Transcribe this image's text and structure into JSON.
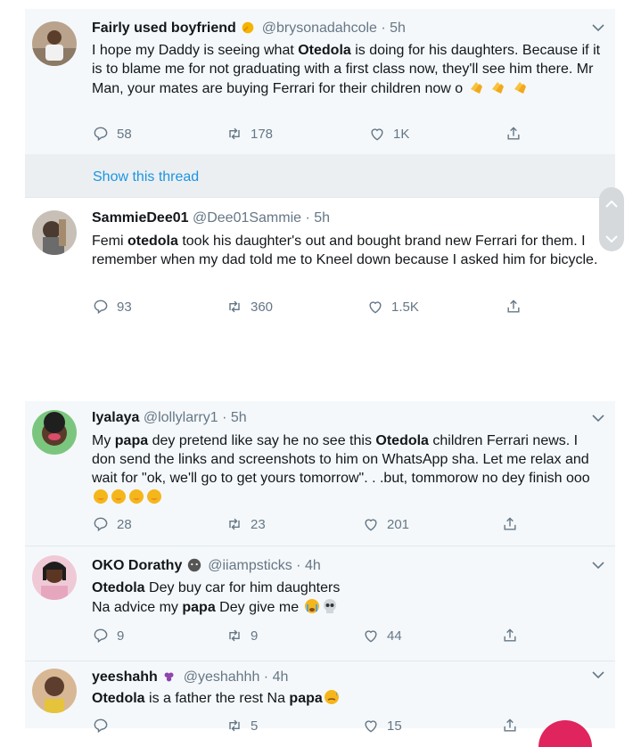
{
  "tweets": [
    {
      "name": "Fairly used boyfriend",
      "handle": "@brysonadahcole · 5h",
      "text_html": "I hope my Daddy is seeing what <b>Otedola</b> is doing for his daughters. Because if it is to blame me for not graduating with a first class now, they'll see him there. Mr Man, your mates are buying Ferrari for their children now o",
      "replies": "58",
      "retweets": "178",
      "likes": "1K"
    },
    {
      "name": "SammieDee01",
      "handle": "@Dee01Sammie · 5h",
      "text_html": "Femi <b>otedola</b> took his daughter's out and bought brand new Ferrari for them. I remember when my dad told me to Kneel down because I asked him for bicycle.",
      "replies": "93",
      "retweets": "360",
      "likes": "1.5K"
    },
    {
      "name": "Iyalaya",
      "handle": "@lollylarry1 · 5h",
      "text_html": "My <b>papa</b> dey pretend like say he no see this <b>Otedola</b> children Ferrari news. I don send the links and screenshots to him on WhatsApp sha. Let me relax and wait for \"ok, we'll go to get yours tomorrow\". . .but, tommorow no dey finish ooo",
      "replies": "28",
      "retweets": "23",
      "likes": "201"
    },
    {
      "name": "OKO Dorathy",
      "handle": "@iiampsticks · 4h",
      "text_html": "<b>Otedola</b> Dey buy car for him daughters<br>Na advice my <b>papa</b> Dey give me",
      "replies": "9",
      "retweets": "9",
      "likes": "44"
    },
    {
      "name": "yeeshahh",
      "handle": "@yeshahhh · 4h",
      "text_html": "<b>Otedola</b> is a father the rest Na <b>papa</b>",
      "replies": "",
      "retweets": "5",
      "likes": "15"
    }
  ],
  "thread_link": "Show this thread",
  "colors": {
    "accent": "#1b95e0",
    "muted": "#657786",
    "bg_alt": "#f5f8fa"
  },
  "icons": [
    "reply-icon",
    "retweet-icon",
    "like-icon",
    "share-icon",
    "chevron-down-icon",
    "clap-emoji",
    "crying-emoji",
    "skull-emoji",
    "sweat-emoji",
    "grape-emoji"
  ]
}
